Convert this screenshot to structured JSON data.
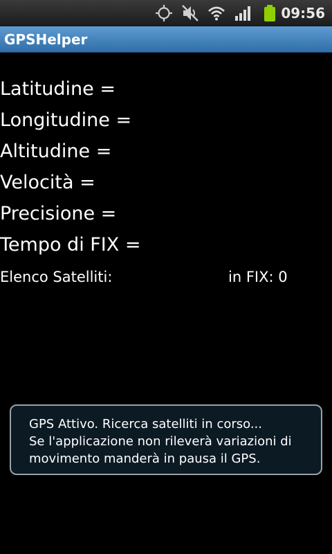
{
  "status_bar": {
    "time": "09:56",
    "icons": [
      "gps-icon",
      "mute-icon",
      "wifi-icon",
      "signal-icon",
      "battery-icon"
    ],
    "battery_color": "#8ed000"
  },
  "app": {
    "title": "GPSHelper",
    "title_bar_color": "#3f7fbb"
  },
  "fields": {
    "latitude": "Latitudine =",
    "longitude": "Longitudine =",
    "altitude": "Altitudine =",
    "speed": "Velocità =",
    "precision": "Precisione =",
    "fix_time": "Tempo di FIX ="
  },
  "satellites": {
    "list_label": "Elenco Satelliti:",
    "in_fix": "in FIX: 0"
  },
  "toast": {
    "line1": "GPS Attivo. Ricerca satelliti in corso...",
    "line2": "Se l'applicazione non rileverà variazioni di",
    "line3": "movimento manderà in pausa il GPS."
  }
}
